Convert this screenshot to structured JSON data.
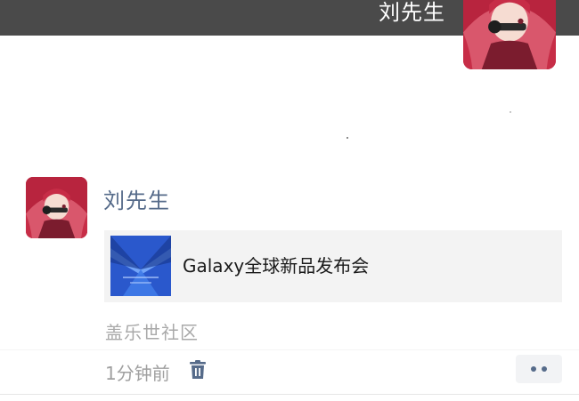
{
  "header": {
    "name": "刘先生",
    "background_color": "#4a4a4a"
  },
  "post": {
    "author": "刘先生",
    "author_color": "#566b8a",
    "link_card": {
      "title": "Galaxy全球新品发布会",
      "thumbnail_icon": "galaxy-event-thumbnail"
    },
    "source": "盖乐世社区",
    "time": "1分钟前",
    "delete_icon": "trash-icon",
    "more_icon": "more-dots-icon"
  },
  "colors": {
    "accent": "#566b8a",
    "card_background": "#f3f3f3",
    "muted_text": "#a9a9a9"
  }
}
